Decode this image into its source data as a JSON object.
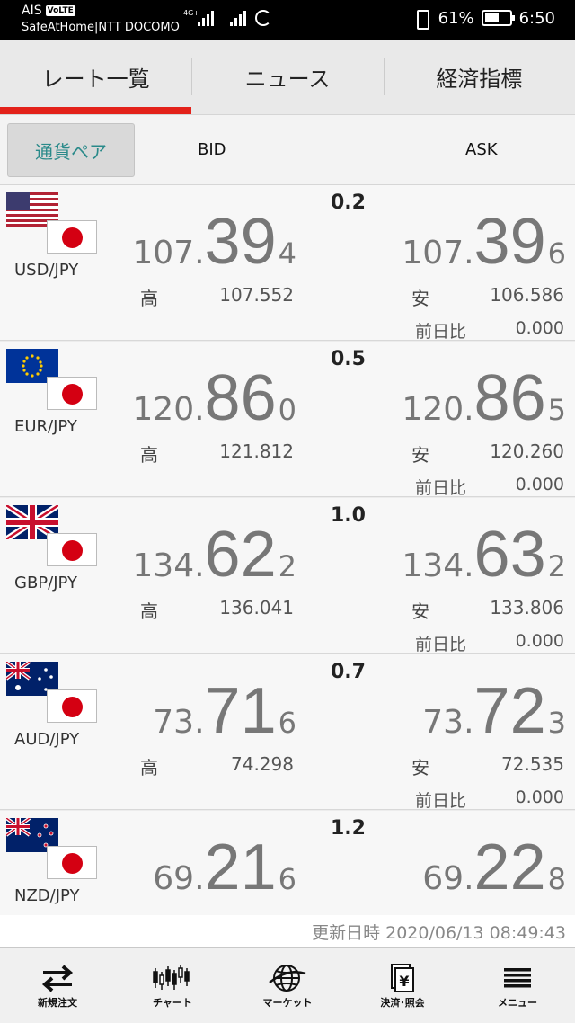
{
  "status_bar": {
    "carrier1": "AIS",
    "volte": "VoLTE",
    "carrier2": "SafeAtHome|NTT DOCOMO",
    "battery_pct": "61%",
    "battery_level": 0.61,
    "time": "6:50"
  },
  "tabs": [
    {
      "label": "レート一覧",
      "active": true
    },
    {
      "label": "ニュース",
      "active": false
    },
    {
      "label": "経済指標",
      "active": false
    }
  ],
  "header": {
    "pair_button": "通貨ペア",
    "bid": "BID",
    "ask": "ASK"
  },
  "labels": {
    "high": "高",
    "low": "安",
    "prev_change": "前日比"
  },
  "rows": [
    {
      "pair": "USD/JPY",
      "spread": "0.2",
      "bid": {
        "pre": "107.",
        "big": "39",
        "pip": "4"
      },
      "ask": {
        "pre": "107.",
        "big": "39",
        "pip": "6"
      },
      "high": "107.552",
      "low": "106.586",
      "change": "0.000"
    },
    {
      "pair": "EUR/JPY",
      "spread": "0.5",
      "bid": {
        "pre": "120.",
        "big": "86",
        "pip": "0"
      },
      "ask": {
        "pre": "120.",
        "big": "86",
        "pip": "5"
      },
      "high": "121.812",
      "low": "120.260",
      "change": "0.000"
    },
    {
      "pair": "GBP/JPY",
      "spread": "1.0",
      "bid": {
        "pre": "134.",
        "big": "62",
        "pip": "2"
      },
      "ask": {
        "pre": "134.",
        "big": "63",
        "pip": "2"
      },
      "high": "136.041",
      "low": "133.806",
      "change": "0.000"
    },
    {
      "pair": "AUD/JPY",
      "spread": "0.7",
      "bid": {
        "pre": "73.",
        "big": "71",
        "pip": "6"
      },
      "ask": {
        "pre": "73.",
        "big": "72",
        "pip": "3"
      },
      "high": "74.298",
      "low": "72.535",
      "change": "0.000"
    },
    {
      "pair": "NZD/JPY",
      "spread": "1.2",
      "bid": {
        "pre": "69.",
        "big": "21",
        "pip": "6"
      },
      "ask": {
        "pre": "69.",
        "big": "22",
        "pip": "8"
      },
      "high": "",
      "low": "",
      "change": ""
    }
  ],
  "updated": "更新日時  2020/06/13 08:49:43",
  "bottom_nav": [
    {
      "label": "新規注文",
      "icon": "swap-arrows-icon"
    },
    {
      "label": "チャート",
      "icon": "candlestick-chart-icon"
    },
    {
      "label": "マーケット",
      "icon": "globe-icon"
    },
    {
      "label": "決済･照会",
      "icon": "document-yen-icon"
    },
    {
      "label": "メニュー",
      "icon": "hamburger-menu-icon"
    }
  ]
}
